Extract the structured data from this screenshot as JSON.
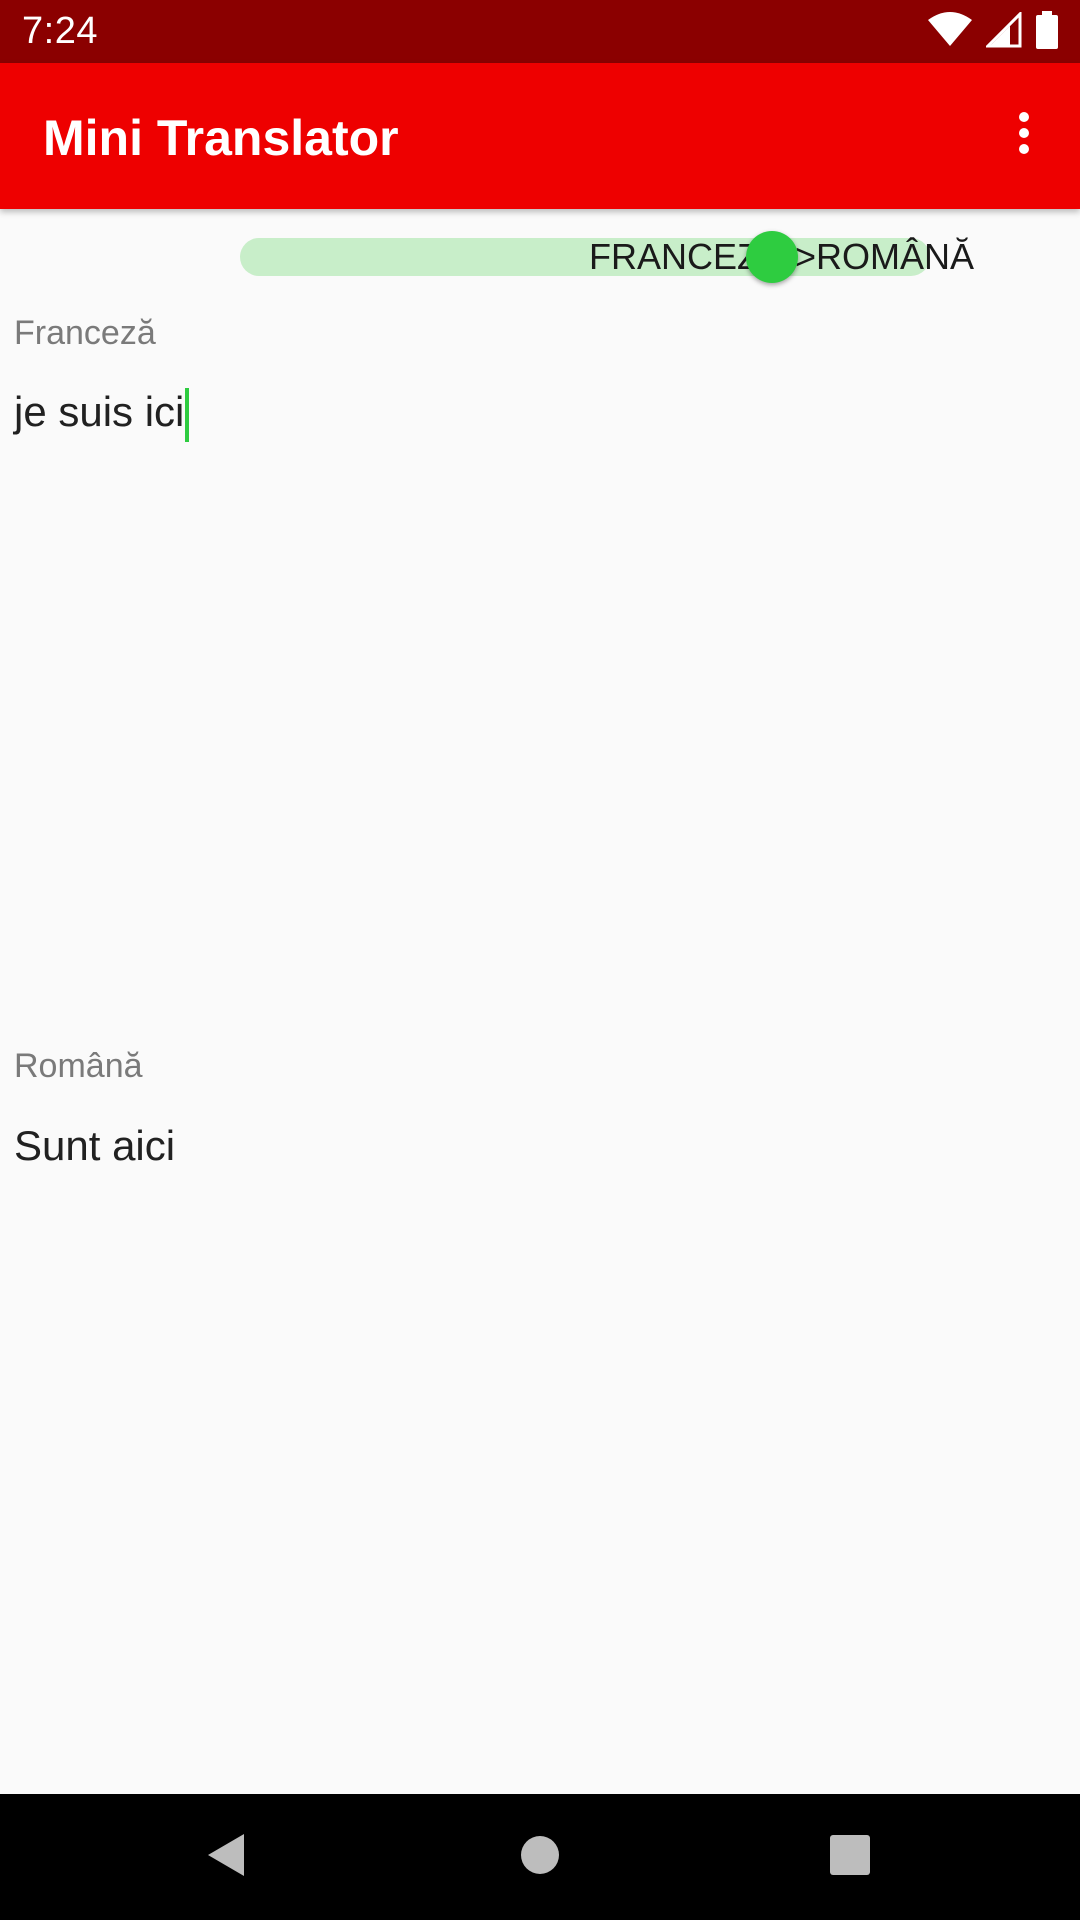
{
  "status_bar": {
    "time": "7:24",
    "icons": [
      "wifi-icon",
      "signal-icon",
      "battery-icon"
    ]
  },
  "app_bar": {
    "title": "Mini Translator",
    "menu_icon": "more-vert-icon"
  },
  "direction_switch": {
    "label": "FRANCEZĂ->ROMÂNĂ",
    "checked": true,
    "track_color": "#c8eec9",
    "thumb_color": "#2ecc40"
  },
  "source": {
    "label": "Franceză",
    "text": "je suis ici"
  },
  "target": {
    "label": "Română",
    "text": "Sunt aici"
  },
  "nav_bar": {
    "icons": [
      "back-icon",
      "home-icon",
      "recents-icon"
    ]
  },
  "colors": {
    "status_bar": "#8b0000",
    "app_bar": "#ee0000",
    "accent": "#2ecc40"
  }
}
